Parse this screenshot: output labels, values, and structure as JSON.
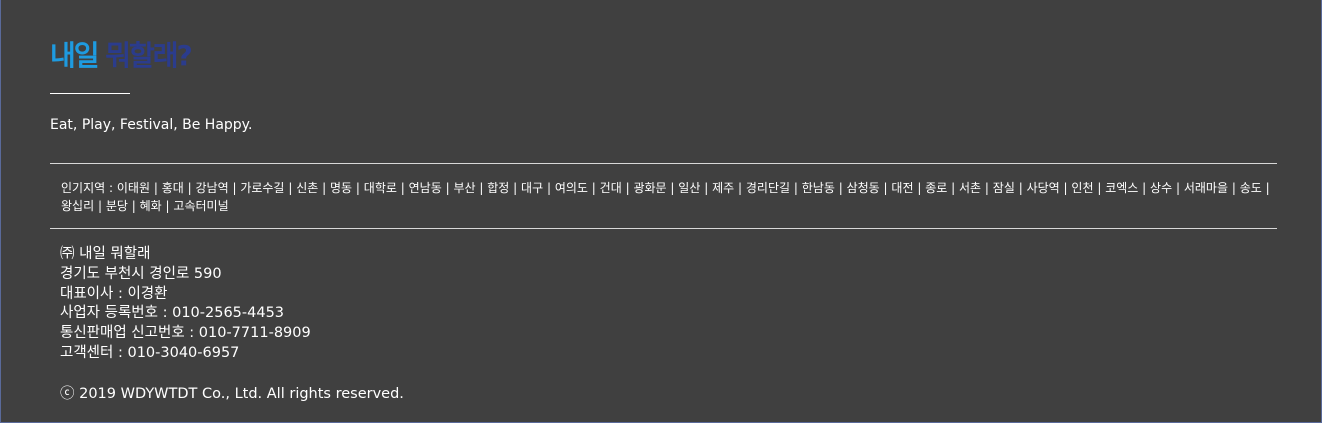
{
  "brand": {
    "logo_part1": "내일",
    "logo_part2": "뭐할래?",
    "tagline": "Eat, Play, Festival, Be Happy."
  },
  "regions": {
    "label": "인기지역 :",
    "items": [
      "이태원",
      "홍대",
      "강남역",
      "가로수길",
      "신촌",
      "명동",
      "대학로",
      "연남동",
      "부산",
      "합정",
      "대구",
      "여의도",
      "건대",
      "광화문",
      "일산",
      "제주",
      "경리단길",
      "한남동",
      "삼청동",
      "대전",
      "종로",
      "서촌",
      "잠실",
      "사당역",
      "인천",
      "코엑스",
      "상수",
      "서래마을",
      "송도",
      "왕십리",
      "분당",
      "혜화",
      "고속터미널"
    ],
    "separator": "|"
  },
  "company": {
    "name": "㈜ 내일 뭐할래",
    "address": "경기도 부천시 경인로 590",
    "ceo": "대표이사 : 이경환",
    "business_number": "사업자 등록번호 : 010-2565-4453",
    "ecommerce_number": "통신판매업 신고번호 : 010-7711-8909",
    "customer_center": "고객센터 : 010-3040-6957"
  },
  "copyright": "ⓒ 2019 WDYWTDT Co., Ltd. All rights reserved.",
  "colors": {
    "background": "#404040",
    "logo_blue": "#1e9be0",
    "logo_navy": "#2b3c8c",
    "text": "#ffffff"
  }
}
